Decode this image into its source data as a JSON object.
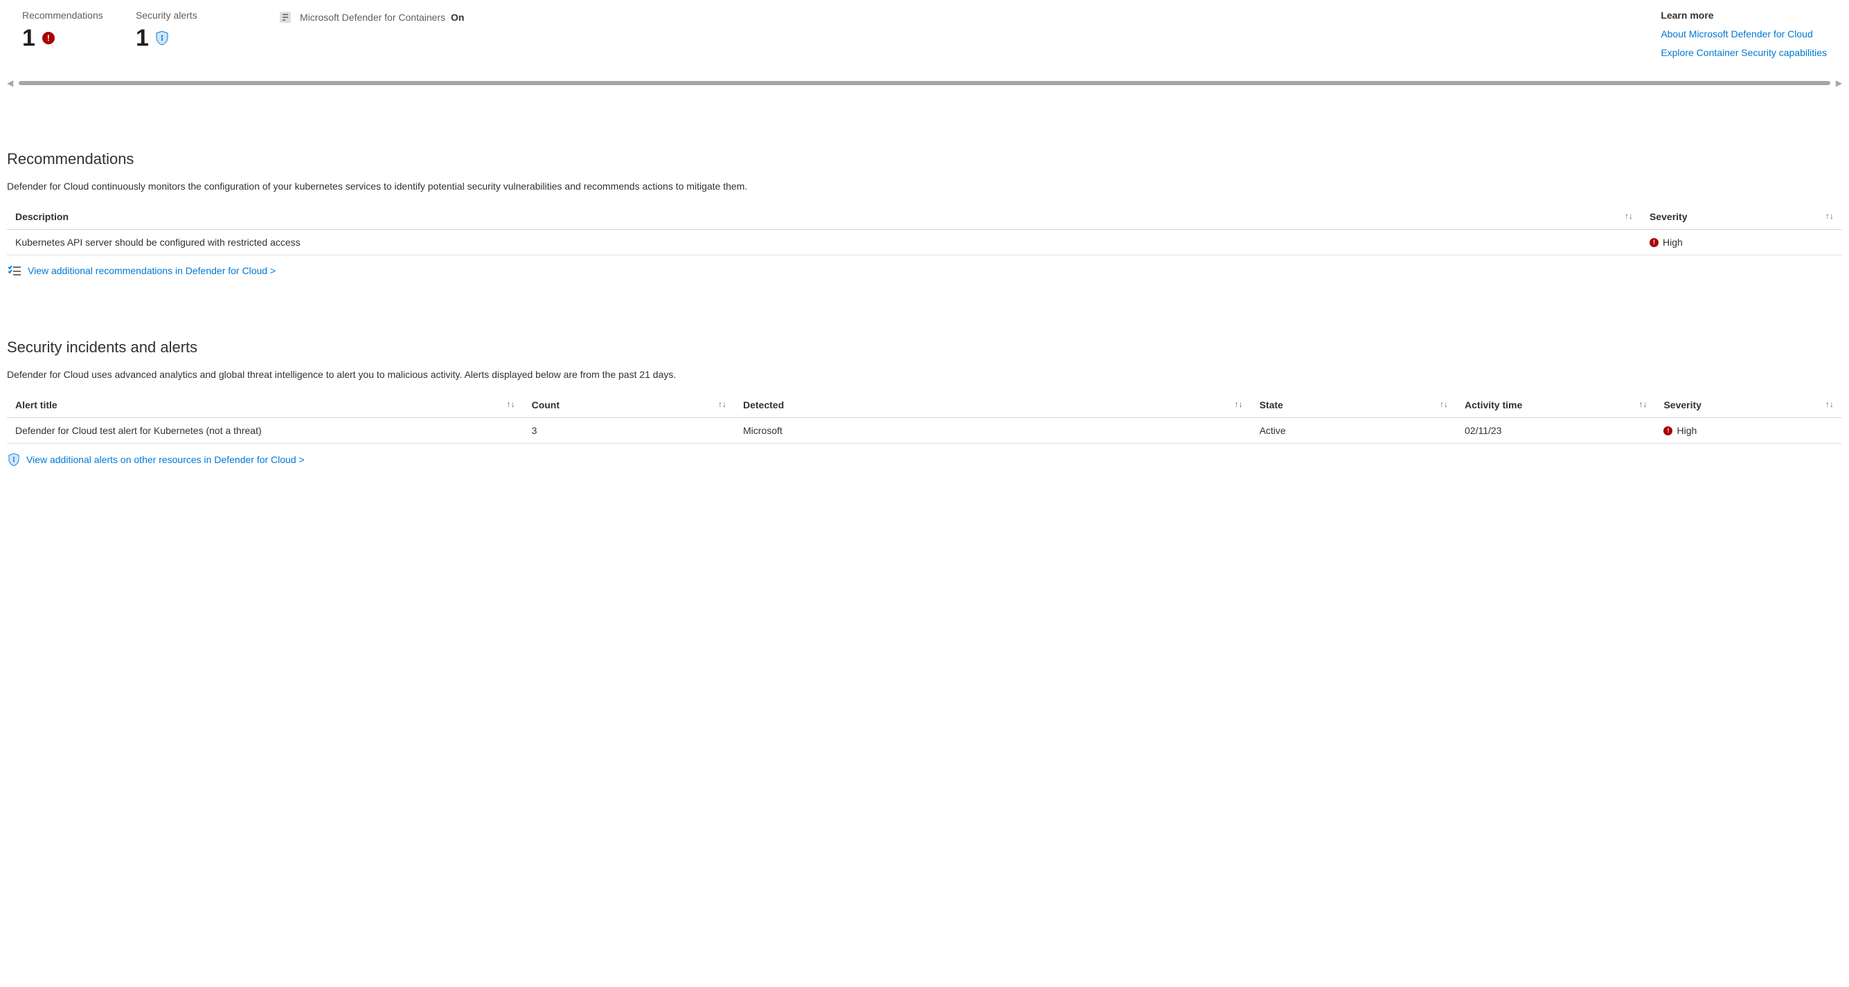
{
  "summary": {
    "recommendations": {
      "label": "Recommendations",
      "count": "1"
    },
    "alerts": {
      "label": "Security alerts",
      "count": "1"
    },
    "defender": {
      "label": "Microsoft Defender for Containers",
      "status": "On"
    }
  },
  "learn_more": {
    "title": "Learn more",
    "links": [
      "About Microsoft Defender for Cloud",
      "Explore Container Security capabilities"
    ]
  },
  "recommendations": {
    "title": "Recommendations",
    "description": "Defender for Cloud continuously monitors the configuration of your kubernetes services to identify potential security vulnerabilities and recommends actions to mitigate them.",
    "columns": {
      "description": "Description",
      "severity": "Severity"
    },
    "rows": [
      {
        "description": "Kubernetes API server should be configured with restricted access",
        "severity": "High"
      }
    ],
    "view_more": "View additional recommendations in Defender for Cloud >"
  },
  "alerts": {
    "title": "Security incidents and alerts",
    "description": "Defender for Cloud uses advanced analytics and global threat intelligence to alert you to malicious activity. Alerts displayed below are from the past 21 days.",
    "columns": {
      "title": "Alert title",
      "count": "Count",
      "detected": "Detected",
      "state": "State",
      "activity": "Activity time",
      "severity": "Severity"
    },
    "rows": [
      {
        "title": "Defender for Cloud test alert for Kubernetes (not a threat)",
        "count": "3",
        "detected": "Microsoft",
        "state": "Active",
        "activity": "02/11/23",
        "severity": "High"
      }
    ],
    "view_more": "View additional alerts on other resources in Defender for Cloud >"
  }
}
